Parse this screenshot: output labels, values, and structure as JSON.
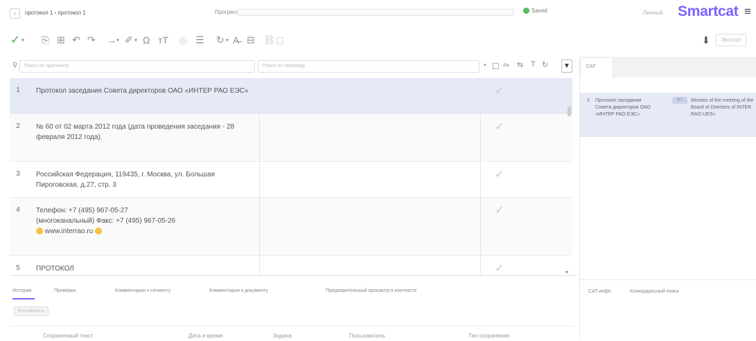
{
  "header": {
    "back_icon": "‹",
    "breadcrumb": "протокол 1 › протокол 1",
    "progress_label": "Прогресс",
    "saved_label": "Saved",
    "saved_color": "#5cb85c",
    "user_label": "Личный",
    "logo": "Smartcat",
    "brand_color": "#7b61ff",
    "menu_icon": "≡"
  },
  "toolbar": {
    "confirm_icon": "✓",
    "icons": [
      "check-icon",
      "copy-source-icon",
      "insert-tags-icon",
      "undo-icon",
      "redo-icon",
      "next-icon",
      "clear-icon",
      "special-chars-icon",
      "case-icon",
      "more-icon",
      "align-icon",
      "history-icon",
      "spellcheck-icon",
      "concordance-icon",
      "link-icon",
      "comment-icon"
    ],
    "download_icon": "⬇",
    "export_label": "Экспорт"
  },
  "filter": {
    "source_placeholder": "Поиск по оригиналу",
    "target_placeholder": "Поиск по переводу",
    "ab_label": "Aa"
  },
  "segments": [
    {
      "num": "1",
      "source": "Протокол заседания Совета директоров ОАО «ИНТЕР РАО ЕЭС»",
      "target": "",
      "active": true
    },
    {
      "num": "2",
      "source": "№ 60 от 02 марта 2012 года (дата проведения заседания - 28 февраля 2012 года).",
      "target": ""
    },
    {
      "num": "3",
      "source": "Российская Федерация, 119435, г. Москва, ул. Большая Пироговская, д.27, стр. 3",
      "target": ""
    },
    {
      "num": "4",
      "source_line1": "Телефон: +7 (495) 967-05-27",
      "source_line2": "(многоканальный) Факс: +7 (495) 967-05-26",
      "source_link": "www.interrao.ru",
      "target": ""
    },
    {
      "num": "5",
      "source": "ПРОТОКОЛ",
      "target": ""
    }
  ],
  "bottom": {
    "tabs": [
      "История",
      "Проверка",
      "Комментарии к сегменту",
      "Комментарии к документу",
      "Предварительный просмотр в контексте"
    ],
    "restore_label": "Восстановить",
    "columns": [
      "Сохраненный текст",
      "Дата и время",
      "Задача",
      "Пользователь",
      "Тип сохранения"
    ]
  },
  "cat": {
    "tab_label": "CAT",
    "match": {
      "num": "1",
      "source": "Протокол заседания Совета директоров ОАО «ИНТЕР РАО ЕЭС»",
      "percent": "MT",
      "target": "Minutes of the meeting of the Board of Directors of INTER RAO UES»"
    },
    "bottom_tabs": [
      "CAT-инфо",
      "Конкордансный поиск"
    ]
  }
}
